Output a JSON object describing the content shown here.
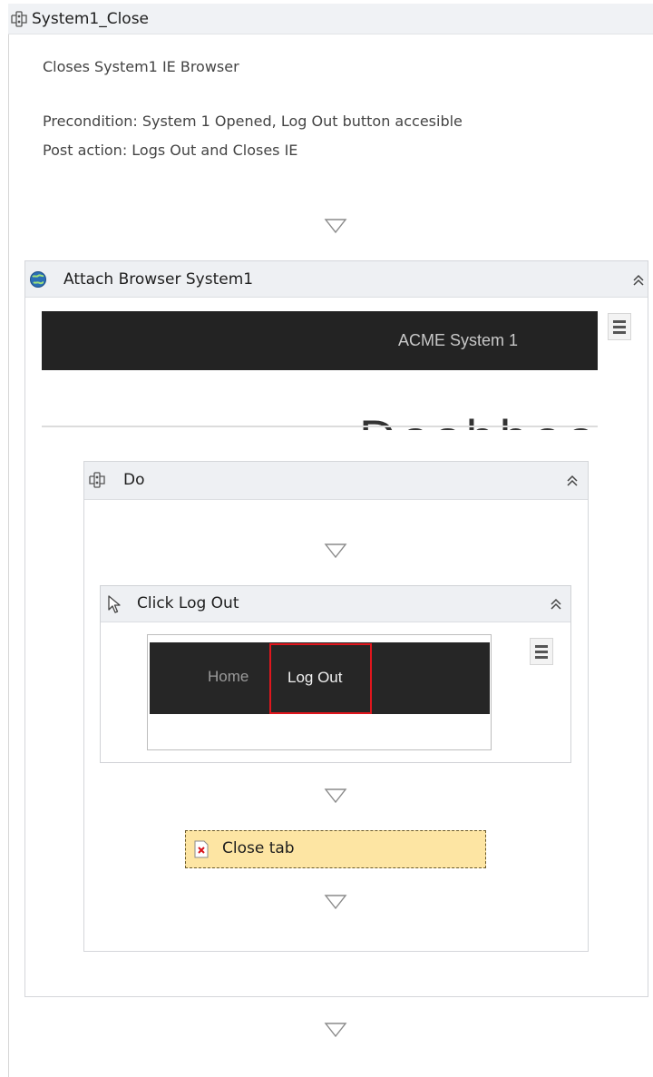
{
  "sequence": {
    "title": "System1_Close",
    "description": "Closes System1 IE Browser",
    "precondition": "Precondition: System 1 Opened, Log Out button accesible",
    "post_action": "Post action: Logs Out and Closes IE"
  },
  "attach_browser": {
    "title": "Attach Browser System1",
    "banner_text": "ACME System 1",
    "dashboard_text": "Dashboard"
  },
  "do_block": {
    "title": "Do"
  },
  "click_activity": {
    "title": "Click Log Out",
    "nav_home": "Home",
    "nav_logout": "Log Out"
  },
  "close_tab": {
    "title": "Close tab"
  },
  "icons": {
    "sequence": "sequence-icon",
    "attach_browser": "globe-icon",
    "click": "cursor-icon",
    "close_tab": "error-document-icon",
    "collapse": "double-chevron-up-icon",
    "menu": "hamburger-icon",
    "flow": "triangle-down-icon"
  },
  "colors": {
    "header_bg": "#eef0f3",
    "banner_bg": "#232323",
    "highlight": "#e0161d",
    "close_tab_bg": "#fde5a3"
  }
}
